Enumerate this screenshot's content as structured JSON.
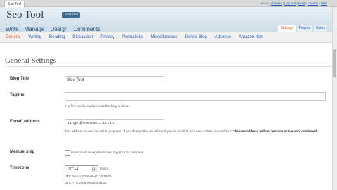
{
  "browser": {
    "tab_title": "Seo Tool"
  },
  "user_links": {
    "prefix": "Howdy,",
    "username": "uberalis",
    "sep": "|",
    "logout": "Log Out",
    "help": "Help",
    "forums": "Forums",
    "extra": "Web"
  },
  "header": {
    "site_title": "Seo Tool",
    "visit_site": "Visit Site",
    "nav": [
      "Write",
      "Manage",
      "Design",
      "Comments"
    ],
    "side_tabs": [
      "Settings",
      "Plugins",
      "Users"
    ]
  },
  "subnav": {
    "items": [
      "General",
      "Writing",
      "Reading",
      "Discussion",
      "Privacy",
      "Permalinks",
      "Miscellaneous",
      "Delete Blog",
      "Adsense",
      "Amazon Item"
    ]
  },
  "page": {
    "title": "General Settings",
    "blog_title": {
      "label": "Blog Title",
      "value": "Seo Tool"
    },
    "tagline": {
      "label": "Tagline",
      "value": "",
      "help": "In a few words, explain what this blog is about."
    },
    "email": {
      "label": "E-mail address",
      "value": "tingel@trensmeii.co.th",
      "help": "This address is used for admin purposes. If you change this we will send you an email at your new address to confirm it.",
      "help_bold": "The new address will not become active until confirmed."
    },
    "membership": {
      "label": "Membership",
      "checkbox_label": "Users must be registered and logged in to comment"
    },
    "timezone": {
      "label": "Timezone",
      "selected": "UTC -4",
      "unit": "hours",
      "utc_time": "UTC time is 2008-08-20 10:48:00",
      "local_time": "UTC -4 is 2008-08-20 6:48:00"
    }
  }
}
